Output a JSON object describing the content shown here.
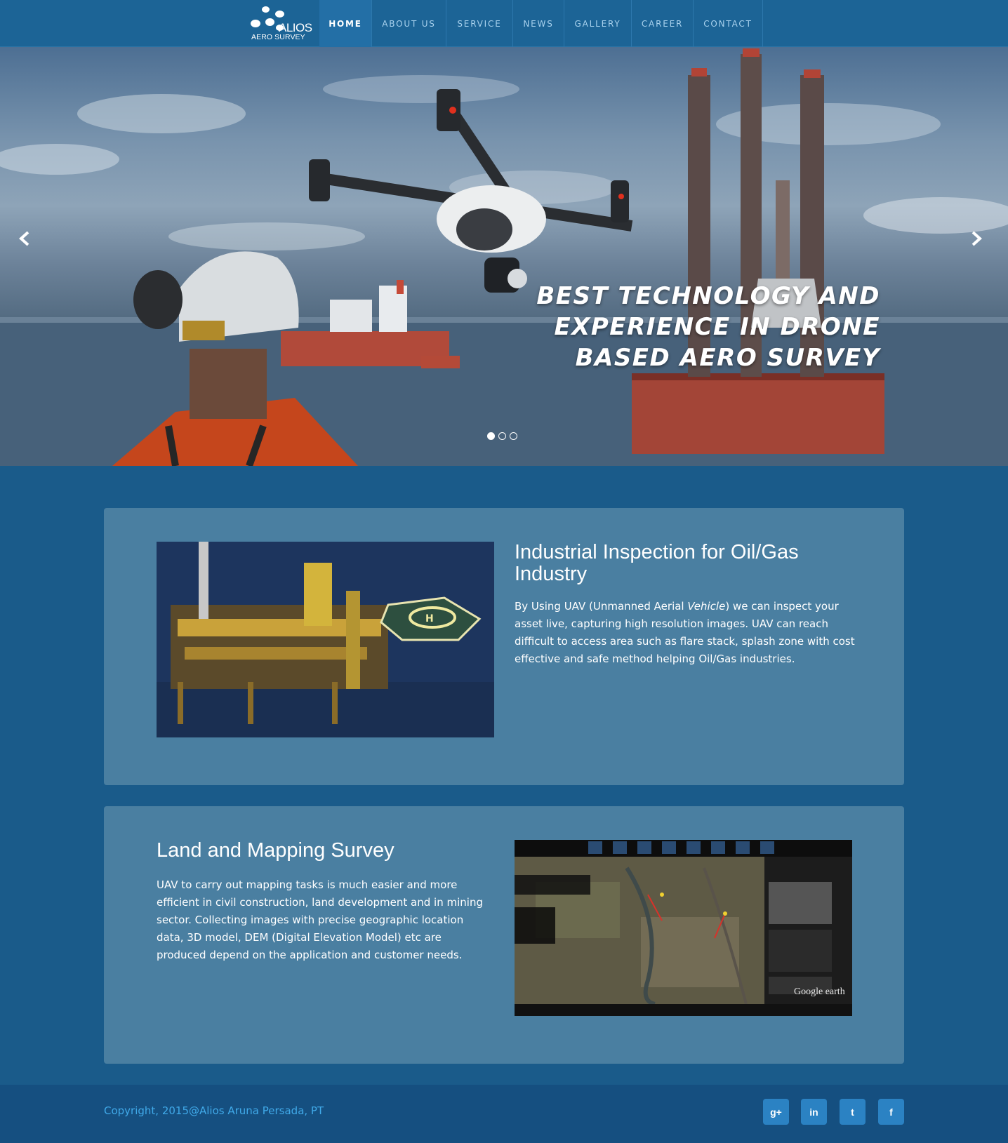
{
  "nav": {
    "logo": {
      "brand": "ALIOS",
      "sub": "AERO SURVEY"
    },
    "items": [
      {
        "label": "HOME",
        "active": true
      },
      {
        "label": "ABOUT US"
      },
      {
        "label": "SERVICE"
      },
      {
        "label": "NEWS"
      },
      {
        "label": "GALLERY"
      },
      {
        "label": "CAREER"
      },
      {
        "label": "CONTACT"
      }
    ]
  },
  "hero": {
    "headline_lines": [
      "BEST TECHNOLOGY AND",
      "EXPERIENCE IN DRONE",
      "BASED AERO SURVEY"
    ],
    "prev_icon": "chevron-left-icon",
    "next_icon": "chevron-right-icon",
    "slide_count": 3,
    "active_slide": 1
  },
  "sections": [
    {
      "title": "Industrial Inspection for Oil/Gas Industry",
      "body_before": "By Using UAV (Unmanned Aerial ",
      "body_em": "Vehicle",
      "body_after": ") we can inspect your asset live, capturing high resolution images. UAV can reach difficult to access area such as flare stack, splash zone with cost effective and safe method helping Oil/Gas industries."
    },
    {
      "title": "Land and Mapping Survey",
      "body": "UAV to carry out mapping tasks is much easier and more efficient in civil construction, land development and in mining sector. Collecting images with precise geographic location data, 3D model, DEM (Digital Elevation Model) etc are produced depend on the application and customer needs.",
      "map_watermark": "Google earth"
    }
  ],
  "footer": {
    "copyright": "Copyright, 2015@Alios Aruna Persada, PT",
    "social": [
      {
        "icon": "google-plus-icon",
        "glyph": "g+"
      },
      {
        "icon": "linkedin-icon",
        "glyph": "in"
      },
      {
        "icon": "twitter-icon",
        "glyph": "t"
      },
      {
        "icon": "facebook-icon",
        "glyph": "f"
      }
    ]
  },
  "colors": {
    "page_bg": "#1a5b8a",
    "nav_bg": "#1c6496",
    "card_bg": "#4a7fa1",
    "footer_bg": "#154f80",
    "copyright_text": "#40a9e8",
    "social_bg": "#2b82c3"
  }
}
